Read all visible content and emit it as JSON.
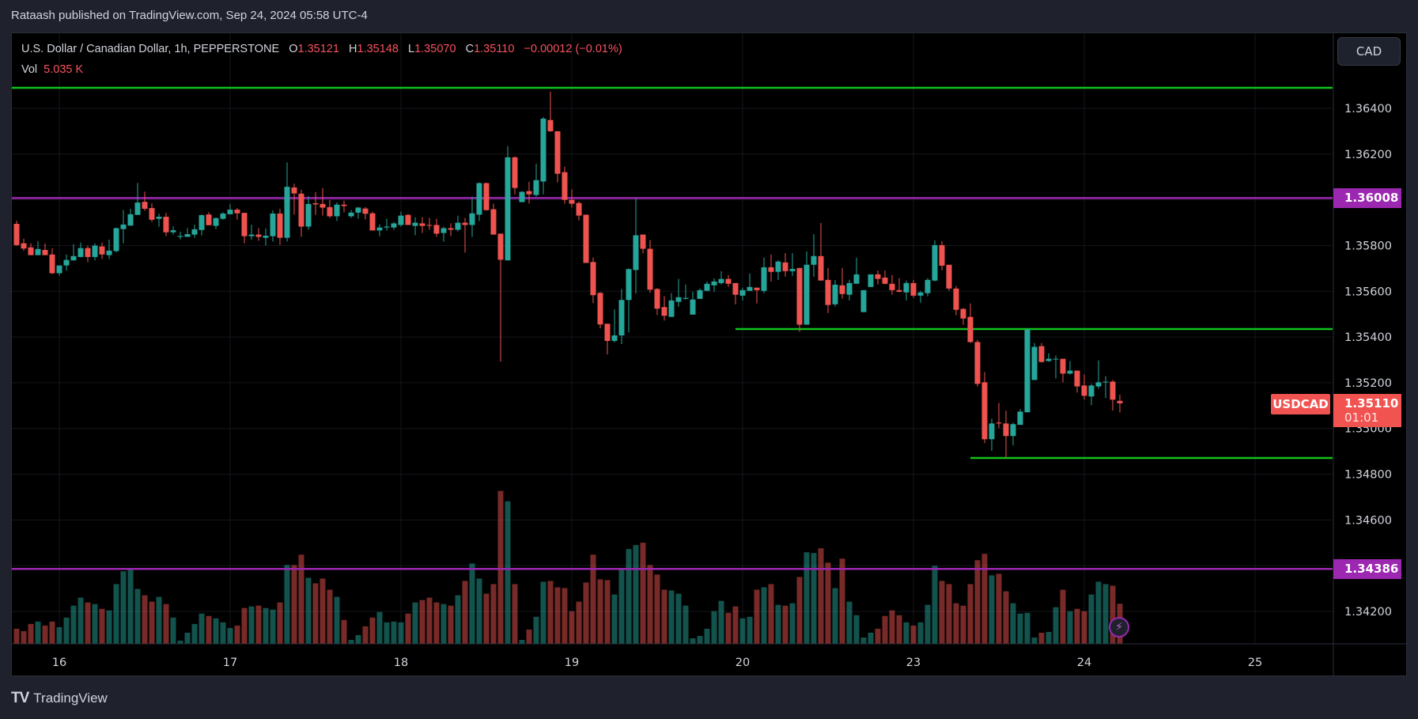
{
  "publish_line": "Rataash published on TradingView.com, Sep 24, 2024 05:58 UTC-4",
  "legend": {
    "symbol": "U.S. Dollar / Canadian Dollar, 1h, PEPPERSTONE",
    "o_label": "O",
    "o": "1.35121",
    "h_label": "H",
    "h": "1.35148",
    "l_label": "L",
    "l": "1.35070",
    "c_label": "C",
    "c": "1.35110",
    "change": "−0.00012 (−0.01%)",
    "vol_label": "Vol",
    "vol": "5.035 K"
  },
  "currency_button": "CAD",
  "symbol_label": "USDCAD",
  "last_price": "1.35110",
  "countdown": "01:01",
  "level_badges": [
    "1.36008",
    "1.34386"
  ],
  "brand": "TradingView",
  "colors": {
    "up": "#26a69a",
    "down": "#ef5350",
    "level_green": "#12c21e",
    "level_purple": "#9c27b0",
    "background": "#000000"
  },
  "icons": {
    "logo": "tradingview-logo-icon",
    "alert": "lightning-icon"
  },
  "chart_data": {
    "type": "candlestick",
    "interval": "1h",
    "price_ticks": [
      "1.36400",
      "1.36200",
      "1.36000",
      "1.35800",
      "1.35600",
      "1.35400",
      "1.35200",
      "1.35000",
      "1.34800",
      "1.34600",
      "1.34400",
      "1.34200"
    ],
    "ylim": [
      1.3412,
      1.3653
    ],
    "time_labels": [
      {
        "label": "16",
        "bar": 7
      },
      {
        "label": "17",
        "bar": 31
      },
      {
        "label": "18",
        "bar": 55
      },
      {
        "label": "19",
        "bar": 79
      },
      {
        "label": "20",
        "bar": 103
      },
      {
        "label": "23",
        "bar": 127
      },
      {
        "label": "24",
        "bar": 151
      },
      {
        "label": "25",
        "bar": 175
      }
    ],
    "horizontal_lines": [
      {
        "price": 1.3649,
        "color": "green",
        "from_bar": 1
      },
      {
        "price": 1.36008,
        "color": "purple",
        "from_bar": 1
      },
      {
        "price": 1.35435,
        "color": "green",
        "from_bar": 102
      },
      {
        "price": 1.34871,
        "color": "green",
        "from_bar": 135
      },
      {
        "price": 1.34386,
        "color": "purple",
        "from_bar": 1
      }
    ],
    "volume_unit": "K",
    "candles_ohlcv": [
      [
        1.35895,
        1.35909,
        1.35799,
        1.35802,
        1.9
      ],
      [
        1.3581,
        1.3583,
        1.35777,
        1.35787,
        1.6
      ],
      [
        1.35792,
        1.3581,
        1.35758,
        1.35758,
        2.5
      ],
      [
        1.35758,
        1.35819,
        1.35758,
        1.35785,
        2.8
      ],
      [
        1.35781,
        1.3581,
        1.35758,
        1.35758,
        2.3
      ],
      [
        1.35761,
        1.35788,
        1.35675,
        1.35679,
        2.8
      ],
      [
        1.35679,
        1.35713,
        1.35669,
        1.35713,
        2.1
      ],
      [
        1.35713,
        1.35761,
        1.3569,
        1.35737,
        3.3
      ],
      [
        1.35735,
        1.35806,
        1.35735,
        1.35754,
        4.8
      ],
      [
        1.3575,
        1.35813,
        1.35749,
        1.35789,
        5.8
      ],
      [
        1.35789,
        1.358,
        1.35727,
        1.3575,
        5.2
      ],
      [
        1.3575,
        1.3581,
        1.35735,
        1.358,
        5.0
      ],
      [
        1.35796,
        1.35813,
        1.35741,
        1.35761,
        4.4
      ],
      [
        1.35758,
        1.35826,
        1.35741,
        1.35778,
        4.2
      ],
      [
        1.35776,
        1.35879,
        1.3577,
        1.35876,
        7.5
      ],
      [
        1.35872,
        1.35955,
        1.3581,
        1.35892,
        9.1
      ],
      [
        1.35887,
        1.35961,
        1.35887,
        1.35937,
        9.4
      ],
      [
        1.35934,
        1.36074,
        1.35934,
        1.35988,
        6.9
      ],
      [
        1.35991,
        1.36036,
        1.35952,
        1.35961,
        6.1
      ],
      [
        1.35964,
        1.35985,
        1.35903,
        1.35913,
        5.3
      ],
      [
        1.35917,
        1.3594,
        1.35882,
        1.35926,
        5.9
      ],
      [
        1.35926,
        1.35943,
        1.35841,
        1.35858,
        5.0
      ],
      [
        1.35858,
        1.35884,
        1.35848,
        1.35867,
        3.3
      ],
      [
        1.35838,
        1.35861,
        1.35827,
        1.35842,
        0.4
      ],
      [
        1.35838,
        1.35877,
        1.35838,
        1.3585,
        1.4
      ],
      [
        1.35848,
        1.35891,
        1.35834,
        1.35871,
        2.5
      ],
      [
        1.35868,
        1.35936,
        1.35844,
        1.35933,
        3.8
      ],
      [
        1.35936,
        1.35946,
        1.35889,
        1.35889,
        3.5
      ],
      [
        1.35886,
        1.35923,
        1.35872,
        1.3592,
        3.2
      ],
      [
        1.35917,
        1.35946,
        1.35913,
        1.3594,
        2.7
      ],
      [
        1.35937,
        1.35981,
        1.35937,
        1.35957,
        2.0
      ],
      [
        1.35957,
        1.35964,
        1.35913,
        1.35941,
        2.3
      ],
      [
        1.35943,
        1.35943,
        1.3581,
        1.35841,
        4.5
      ],
      [
        1.35841,
        1.35891,
        1.35825,
        1.35848,
        4.7
      ],
      [
        1.35848,
        1.35877,
        1.35821,
        1.35838,
        4.8
      ],
      [
        1.35834,
        1.35875,
        1.358,
        1.35843,
        4.5
      ],
      [
        1.35841,
        1.35954,
        1.35817,
        1.3594,
        4.3
      ],
      [
        1.3594,
        1.35961,
        1.35803,
        1.35834,
        5.2
      ],
      [
        1.35834,
        1.36164,
        1.35817,
        1.36057,
        9.9
      ],
      [
        1.36054,
        1.36071,
        1.35935,
        1.36028,
        9.9
      ],
      [
        1.36027,
        1.36044,
        1.35838,
        1.35883,
        11.2
      ],
      [
        1.35883,
        1.36016,
        1.35869,
        1.35982,
        8.3
      ],
      [
        1.35985,
        1.36034,
        1.35934,
        1.3598,
        7.6
      ],
      [
        1.35982,
        1.36051,
        1.35931,
        1.35966,
        8.2
      ],
      [
        1.35968,
        1.35999,
        1.35921,
        1.35928,
        6.8
      ],
      [
        1.35928,
        1.35989,
        1.35907,
        1.35979,
        5.9
      ],
      [
        1.35979,
        1.35996,
        1.35945,
        1.35973,
        3.0
      ],
      [
        1.35928,
        1.35955,
        1.35921,
        1.35944,
        0.5
      ],
      [
        1.35944,
        1.35969,
        1.35918,
        1.35966,
        1.1
      ],
      [
        1.35962,
        1.35969,
        1.35915,
        1.35939,
        2.2
      ],
      [
        1.35941,
        1.35948,
        1.35866,
        1.35866,
        3.3
      ],
      [
        1.35866,
        1.35893,
        1.35841,
        1.35879,
        4.0
      ],
      [
        1.35879,
        1.35917,
        1.35866,
        1.35883,
        2.7
      ],
      [
        1.35879,
        1.35904,
        1.35869,
        1.35897,
        2.8
      ],
      [
        1.3589,
        1.35948,
        1.35883,
        1.35931,
        2.7
      ],
      [
        1.35934,
        1.35938,
        1.3589,
        1.3589,
        3.8
      ],
      [
        1.35886,
        1.35924,
        1.35845,
        1.359,
        5.2
      ],
      [
        1.35897,
        1.35924,
        1.35855,
        1.35886,
        5.5
      ],
      [
        1.3589,
        1.35921,
        1.35869,
        1.35888,
        5.8
      ],
      [
        1.3589,
        1.35917,
        1.35838,
        1.35852,
        5.2
      ],
      [
        1.35855,
        1.35883,
        1.35817,
        1.35876,
        5.0
      ],
      [
        1.35876,
        1.35897,
        1.35841,
        1.35869,
        4.8
      ],
      [
        1.35869,
        1.35931,
        1.35862,
        1.359,
        6.1
      ],
      [
        1.359,
        1.35921,
        1.35769,
        1.3589,
        7.9
      ],
      [
        1.3589,
        1.36014,
        1.35838,
        1.35941,
        10.1
      ],
      [
        1.35935,
        1.36076,
        1.35907,
        1.36073,
        8.2
      ],
      [
        1.36073,
        1.36076,
        1.35952,
        1.35955,
        6.3
      ],
      [
        1.35959,
        1.35983,
        1.35848,
        1.35848,
        7.5
      ],
      [
        1.35852,
        1.35852,
        1.35292,
        1.35738,
        19.2
      ],
      [
        1.35735,
        1.36235,
        1.35735,
        1.36186,
        17.9
      ],
      [
        1.36186,
        1.3619,
        1.36024,
        1.36052,
        7.5
      ],
      [
        1.3599,
        1.36038,
        1.3599,
        1.36035,
        0.5
      ],
      [
        1.36038,
        1.36079,
        1.35983,
        1.36024,
        1.8
      ],
      [
        1.36021,
        1.36158,
        1.36014,
        1.36086,
        3.4
      ],
      [
        1.3608,
        1.36362,
        1.36024,
        1.36355,
        7.8
      ],
      [
        1.36349,
        1.36473,
        1.36297,
        1.363,
        7.9
      ],
      [
        1.363,
        1.363,
        1.36076,
        1.36114,
        7.1
      ],
      [
        1.36121,
        1.36145,
        1.35983,
        1.36,
        7.0
      ],
      [
        1.36,
        1.36045,
        1.35966,
        1.35983,
        4.1
      ],
      [
        1.35986,
        1.35993,
        1.3591,
        1.35931,
        5.3
      ],
      [
        1.35935,
        1.35935,
        1.35724,
        1.35724,
        7.7
      ],
      [
        1.35728,
        1.35748,
        1.35548,
        1.35583,
        11.2
      ],
      [
        1.35593,
        1.35596,
        1.35438,
        1.35455,
        8.1
      ],
      [
        1.35458,
        1.35458,
        1.35324,
        1.35383,
        8.0
      ],
      [
        1.35383,
        1.35521,
        1.35376,
        1.35407,
        6.2
      ],
      [
        1.35407,
        1.3561,
        1.35369,
        1.35562,
        9.4
      ],
      [
        1.35562,
        1.357,
        1.3542,
        1.35697,
        11.9
      ],
      [
        1.35693,
        1.36007,
        1.3559,
        1.35845,
        12.4
      ],
      [
        1.35848,
        1.35848,
        1.35766,
        1.35786,
        12.7
      ],
      [
        1.35786,
        1.35824,
        1.35593,
        1.35607,
        9.9
      ],
      [
        1.3561,
        1.35614,
        1.35496,
        1.35524,
        8.7
      ],
      [
        1.35531,
        1.35579,
        1.35472,
        1.35493,
        6.8
      ],
      [
        1.35488,
        1.35592,
        1.35488,
        1.3556,
        6.7
      ],
      [
        1.35554,
        1.35654,
        1.35533,
        1.35574,
        6.3
      ],
      [
        1.35567,
        1.3563,
        1.35564,
        1.35571,
        4.8
      ],
      [
        1.35498,
        1.35598,
        1.35498,
        1.35564,
        0.7
      ],
      [
        1.35567,
        1.35612,
        1.35567,
        1.35605,
        1.0
      ],
      [
        1.35602,
        1.35643,
        1.35602,
        1.35633,
        1.9
      ],
      [
        1.35626,
        1.35657,
        1.35598,
        1.35643,
        4.1
      ],
      [
        1.35636,
        1.35688,
        1.3563,
        1.35654,
        5.4
      ],
      [
        1.35654,
        1.35671,
        1.35619,
        1.35633,
        3.9
      ],
      [
        1.35636,
        1.35636,
        1.35543,
        1.35585,
        4.7
      ],
      [
        1.35581,
        1.35616,
        1.3556,
        1.35605,
        3.2
      ],
      [
        1.35602,
        1.35678,
        1.35602,
        1.35619,
        3.4
      ],
      [
        1.35616,
        1.35616,
        1.35547,
        1.35605,
        6.8
      ],
      [
        1.35602,
        1.35747,
        1.35592,
        1.35705,
        7.1
      ],
      [
        1.35705,
        1.35761,
        1.35643,
        1.35685,
        7.5
      ],
      [
        1.35685,
        1.35736,
        1.3565,
        1.3573,
        4.9
      ],
      [
        1.35726,
        1.35767,
        1.35664,
        1.35688,
        4.8
      ],
      [
        1.35688,
        1.35767,
        1.35667,
        1.35698,
        5.1
      ],
      [
        1.35702,
        1.35702,
        1.35423,
        1.35454,
        8.4
      ],
      [
        1.35454,
        1.35774,
        1.35454,
        1.35716,
        11.5
      ],
      [
        1.35716,
        1.3585,
        1.35664,
        1.35754,
        11.4
      ],
      [
        1.35754,
        1.35899,
        1.35647,
        1.35647,
        12.0
      ],
      [
        1.3565,
        1.35702,
        1.35505,
        1.3554,
        10.2
      ],
      [
        1.35543,
        1.3565,
        1.35533,
        1.35629,
        7.0
      ],
      [
        1.35626,
        1.35702,
        1.35567,
        1.35588,
        10.7
      ],
      [
        1.35585,
        1.3565,
        1.3556,
        1.35636,
        5.3
      ],
      [
        1.35633,
        1.35747,
        1.35633,
        1.35674,
        3.6
      ],
      [
        1.35509,
        1.35605,
        1.35509,
        1.35605,
        0.8
      ],
      [
        1.35619,
        1.35674,
        1.35619,
        1.35674,
        1.4
      ],
      [
        1.35674,
        1.35691,
        1.3563,
        1.35654,
        1.9
      ],
      [
        1.3566,
        1.35691,
        1.3563,
        1.35633,
        3.5
      ],
      [
        1.35633,
        1.35671,
        1.35585,
        1.35605,
        4.2
      ],
      [
        1.35605,
        1.35657,
        1.35595,
        1.35598,
        3.6
      ],
      [
        1.35595,
        1.35647,
        1.3556,
        1.35636,
        2.7
      ],
      [
        1.35636,
        1.3565,
        1.35571,
        1.35581,
        2.3
      ],
      [
        1.35581,
        1.35602,
        1.3555,
        1.35595,
        2.7
      ],
      [
        1.35592,
        1.35657,
        1.35578,
        1.3565,
        4.9
      ],
      [
        1.35647,
        1.35823,
        1.35643,
        1.35802,
        9.8
      ],
      [
        1.35802,
        1.35819,
        1.35692,
        1.35712,
        7.9
      ],
      [
        1.35716,
        1.35716,
        1.35602,
        1.35612,
        7.5
      ],
      [
        1.35612,
        1.35623,
        1.35495,
        1.35519,
        5.1
      ],
      [
        1.35523,
        1.35526,
        1.35454,
        1.35481,
        4.8
      ],
      [
        1.35488,
        1.35547,
        1.35374,
        1.35378,
        7.5
      ],
      [
        1.35378,
        1.35388,
        1.35184,
        1.35195,
        10.5
      ],
      [
        1.35202,
        1.35247,
        1.34936,
        1.34953,
        11.3
      ],
      [
        1.34953,
        1.35043,
        1.34902,
        1.35022,
        8.6
      ],
      [
        1.35026,
        1.35112,
        1.35002,
        1.35022,
        8.8
      ],
      [
        1.35022,
        1.35078,
        1.34874,
        1.34967,
        6.6
      ],
      [
        1.34967,
        1.35026,
        1.34926,
        1.35019,
        5.1
      ],
      [
        1.35016,
        1.35085,
        1.35016,
        1.35074,
        3.8
      ],
      [
        1.35071,
        1.35436,
        1.35071,
        1.35433,
        3.9
      ],
      [
        1.35212,
        1.35374,
        1.35212,
        1.35357,
        0.8
      ],
      [
        1.3536,
        1.35374,
        1.35288,
        1.35291,
        1.4
      ],
      [
        1.35295,
        1.35329,
        1.35291,
        1.35305,
        1.5
      ],
      [
        1.35303,
        1.35319,
        1.35219,
        1.35305,
        4.6
      ],
      [
        1.35305,
        1.35305,
        1.35202,
        1.3524,
        6.8
      ],
      [
        1.3524,
        1.35295,
        1.35236,
        1.35253,
        4.1
      ],
      [
        1.35253,
        1.35253,
        1.35157,
        1.35184,
        4.4
      ],
      [
        1.35188,
        1.35236,
        1.35126,
        1.35143,
        4.1
      ],
      [
        1.3514,
        1.35195,
        1.35102,
        1.35188,
        6.2
      ],
      [
        1.35184,
        1.35298,
        1.35174,
        1.35202,
        7.8
      ],
      [
        1.35202,
        1.35229,
        1.35133,
        1.35205,
        7.5
      ],
      [
        1.35205,
        1.35212,
        1.35078,
        1.35126,
        7.3
      ],
      [
        1.35121,
        1.35148,
        1.3507,
        1.3511,
        5.035
      ]
    ]
  }
}
